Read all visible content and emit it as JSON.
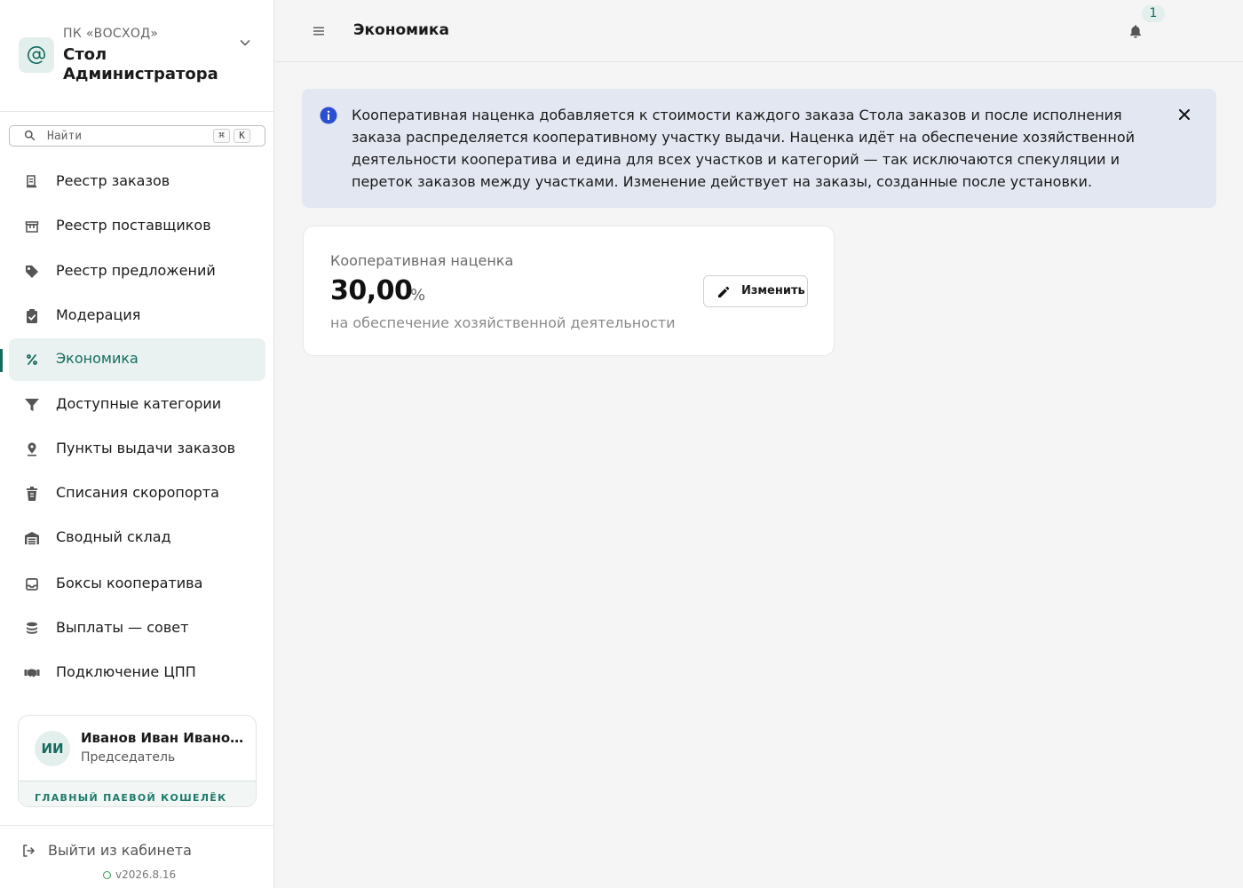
{
  "brand": {
    "org": "ПК «ВОСХОД»",
    "title": "Стол Администратора",
    "logo_icon": "at-sign-icon",
    "accent": "#156b5f"
  },
  "search": {
    "placeholder": "Найти",
    "shortcut_mod": "⌘",
    "shortcut_key": "K"
  },
  "sidebar": {
    "items": [
      {
        "label": "Реестр заказов",
        "icon": "receipt-icon",
        "active": false
      },
      {
        "label": "Реестр поставщиков",
        "icon": "store-icon",
        "active": false
      },
      {
        "label": "Реестр предложений",
        "icon": "tag-icon",
        "active": false
      },
      {
        "label": "Модерация",
        "icon": "clipboard-check-icon",
        "active": false
      },
      {
        "label": "Экономика",
        "icon": "percent-icon",
        "active": true
      },
      {
        "label": "Доступные категории",
        "icon": "filter-icon",
        "active": false
      },
      {
        "label": "Пункты выдачи заказов",
        "icon": "map-pin-icon",
        "active": false
      },
      {
        "label": "Списания скоропорта",
        "icon": "trash-box-icon",
        "active": false
      },
      {
        "label": "Сводный склад",
        "icon": "warehouse-icon",
        "active": false
      },
      {
        "label": "Боксы кооператива",
        "icon": "inbox-icon",
        "active": false
      },
      {
        "label": "Выплаты — совет",
        "icon": "coins-stack-icon",
        "active": false
      },
      {
        "label": "Подключение ЦПП",
        "icon": "handshake-icon",
        "active": false
      }
    ]
  },
  "user": {
    "initials": "ИИ",
    "name": "Иванов Иван Иванович",
    "role": "Председатель",
    "wallet_label": "ГЛАВНЫЙ ПАЕВОЙ КОШЕЛЁК"
  },
  "footer": {
    "logout_label": "Выйти из кабинета",
    "version": "v2026.8.16",
    "status_color": "#2e9e4a"
  },
  "header": {
    "title": "Экономика",
    "notifications_count": "1"
  },
  "banner": {
    "text": "Кооперативная наценка добавляется к стоимости каждого заказа Стола заказов и после исполнения заказа распределяется кооперативному участку выдачи. Наценка идёт на обеспечение хозяйственной деятельности кооператива и едина для всех участков и категорий — так исключаются спекуляции и переток заказов между участками. Изменение действует на заказы, созданные после установки.",
    "background": "#e3e7f1",
    "icon_color": "#2c4fd1"
  },
  "markup_card": {
    "label": "Кооперативная наценка",
    "value": "30,00",
    "unit": "%",
    "description": "на обеспечение хозяйственной деятельности",
    "edit_label": "Изменить"
  }
}
